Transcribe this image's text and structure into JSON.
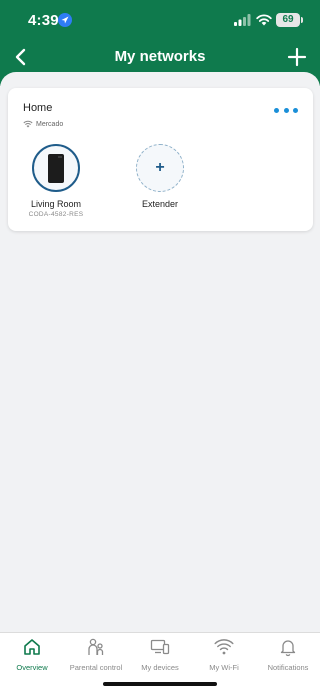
{
  "status_bar": {
    "time": "4:39",
    "battery": "69"
  },
  "header": {
    "title": "My networks",
    "back_icon": "chevron-left-icon",
    "add_icon": "plus-icon"
  },
  "network": {
    "name": "Home",
    "ssid": "Mercado",
    "more_icon": "more-horizontal-icon",
    "devices": [
      {
        "name": "Living Room",
        "id": "CODA-4582-RES",
        "icon": "router-icon"
      }
    ],
    "add_extender": {
      "label": "Extender",
      "symbol": "+"
    }
  },
  "tab_bar": {
    "tabs": [
      {
        "label": "Overview",
        "icon": "home-icon",
        "active": true
      },
      {
        "label": "Parental control",
        "icon": "parental-icon",
        "active": false
      },
      {
        "label": "My devices",
        "icon": "devices-icon",
        "active": false
      },
      {
        "label": "My Wi-Fi",
        "icon": "wifi-icon",
        "active": false
      },
      {
        "label": "Notifications",
        "icon": "bell-icon",
        "active": false
      }
    ]
  },
  "colors": {
    "brand_green": "#0f7a4d",
    "accent_blue": "#1a8fd8",
    "device_ring": "#1f5c8a"
  }
}
